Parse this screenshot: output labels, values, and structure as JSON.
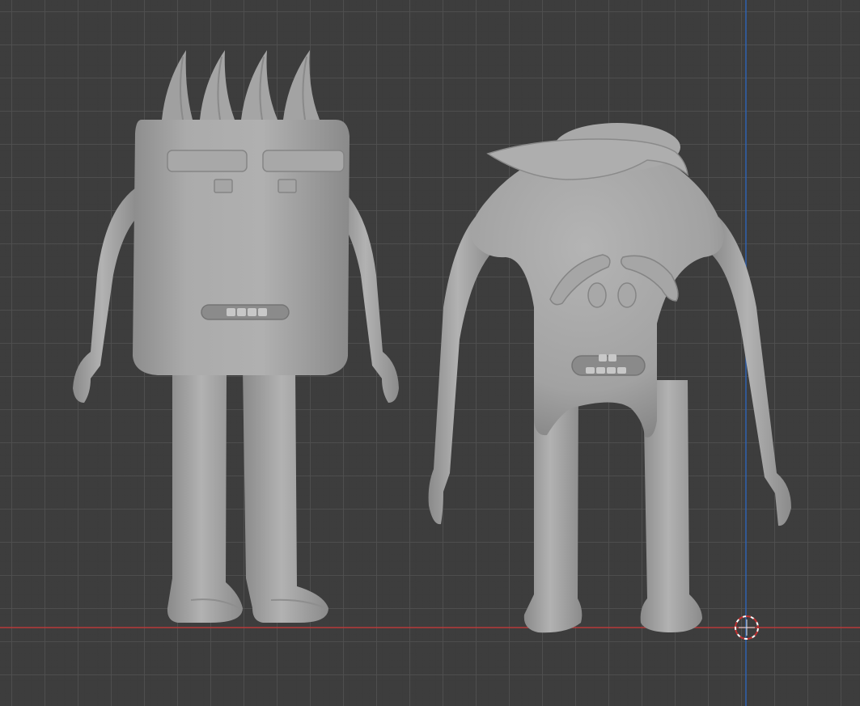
{
  "viewport": {
    "colors": {
      "background": "#3d3d3d",
      "grid": "#525252",
      "x_axis": "#b83a3a",
      "z_axis": "#2f62b0",
      "model": "#a6a6a6",
      "cursor": "#c03030"
    },
    "objects": [
      {
        "name": "block-character"
      },
      {
        "name": "blob-character"
      }
    ],
    "cursor_icon": "3d-cursor-icon"
  }
}
